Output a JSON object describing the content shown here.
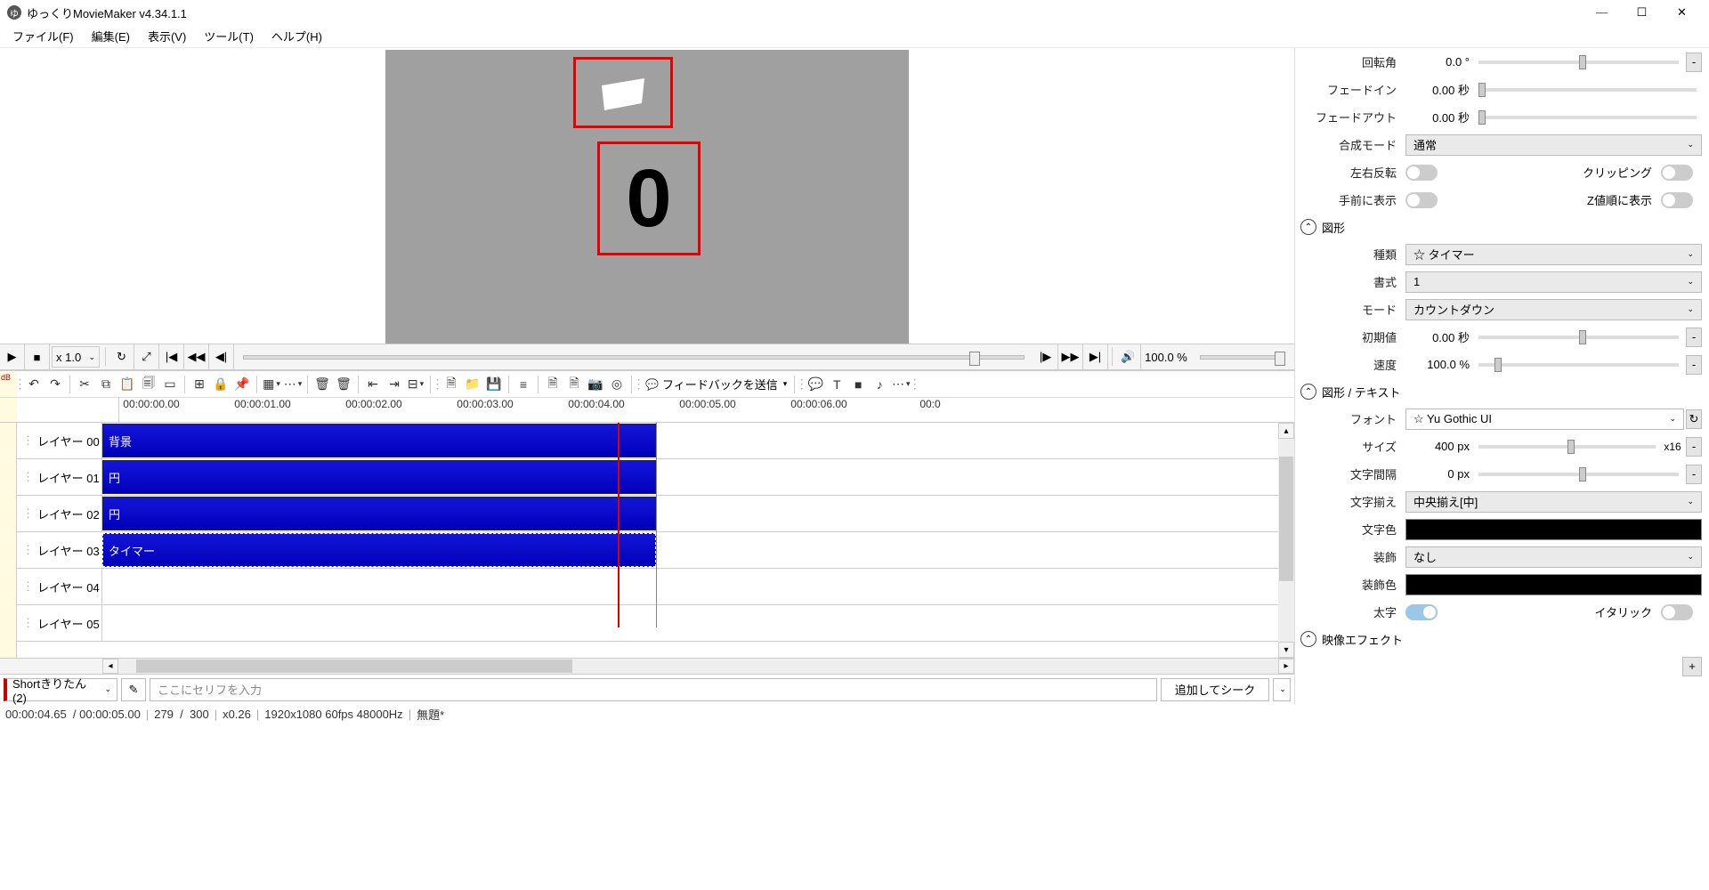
{
  "app": {
    "title": "ゆっくりMovieMaker v4.34.1.1"
  },
  "menu": {
    "file": "ファイル(F)",
    "edit": "編集(E)",
    "view": "表示(V)",
    "tool": "ツール(T)",
    "help": "ヘルプ(H)"
  },
  "preview": {
    "timer_value": "0"
  },
  "playback": {
    "speed": "x 1.0",
    "volume": "100.0 %"
  },
  "panel": {
    "rotation": {
      "label": "回転角",
      "value": "0.0 °"
    },
    "fadein": {
      "label": "フェードイン",
      "value": "0.00 秒"
    },
    "fadeout": {
      "label": "フェードアウト",
      "value": "0.00 秒"
    },
    "blend": {
      "label": "合成モード",
      "value": "通常"
    },
    "fliph": {
      "label": "左右反転"
    },
    "clipping": {
      "label": "クリッピング"
    },
    "front": {
      "label": "手前に表示"
    },
    "zorder": {
      "label": "Z値順に表示"
    },
    "sec_shape": "図形",
    "type": {
      "label": "種類",
      "value": "タイマー"
    },
    "format": {
      "label": "書式",
      "value": "1"
    },
    "mode": {
      "label": "モード",
      "value": "カウントダウン"
    },
    "initial": {
      "label": "初期値",
      "value": "0.00 秒"
    },
    "speed2": {
      "label": "速度",
      "value": "100.0 %"
    },
    "sec_text": "図形 / テキスト",
    "font": {
      "label": "フォント",
      "value": "Yu Gothic UI"
    },
    "size": {
      "label": "サイズ",
      "value": "400 px",
      "mult": "x16"
    },
    "spacing": {
      "label": "文字間隔",
      "value": "0 px"
    },
    "align": {
      "label": "文字揃え",
      "value": "中央揃え[中]"
    },
    "color": {
      "label": "文字色"
    },
    "deco": {
      "label": "装飾",
      "value": "なし"
    },
    "decocolor": {
      "label": "装飾色"
    },
    "bold": {
      "label": "太字"
    },
    "italic": {
      "label": "イタリック"
    },
    "sec_effect": "映像エフェクト"
  },
  "toolbar": {
    "feedback": "フィードバックを送信"
  },
  "ruler": [
    "00:00:00.00",
    "00:00:01.00",
    "00:00:02.00",
    "00:00:03.00",
    "00:00:04.00",
    "00:00:05.00",
    "00:00:06.00",
    "00:0"
  ],
  "layers": [
    {
      "name": "レイヤー 00",
      "clip": "背景"
    },
    {
      "name": "レイヤー 01",
      "clip": "円"
    },
    {
      "name": "レイヤー 02",
      "clip": "円"
    },
    {
      "name": "レイヤー 03",
      "clip": "タイマー",
      "selected": true
    },
    {
      "name": "レイヤー 04"
    },
    {
      "name": "レイヤー 05"
    }
  ],
  "bottom": {
    "voice": "Shortきりたん (2)",
    "placeholder": "ここにセリフを入力",
    "action": "追加してシーク"
  },
  "status": {
    "time": "00:00:04.65",
    "total": "00:00:05.00",
    "frame": "279",
    "frames": "300",
    "zoom": "x0.26",
    "res": "1920x1080 60fps 48000Hz",
    "proj": "無題*"
  }
}
